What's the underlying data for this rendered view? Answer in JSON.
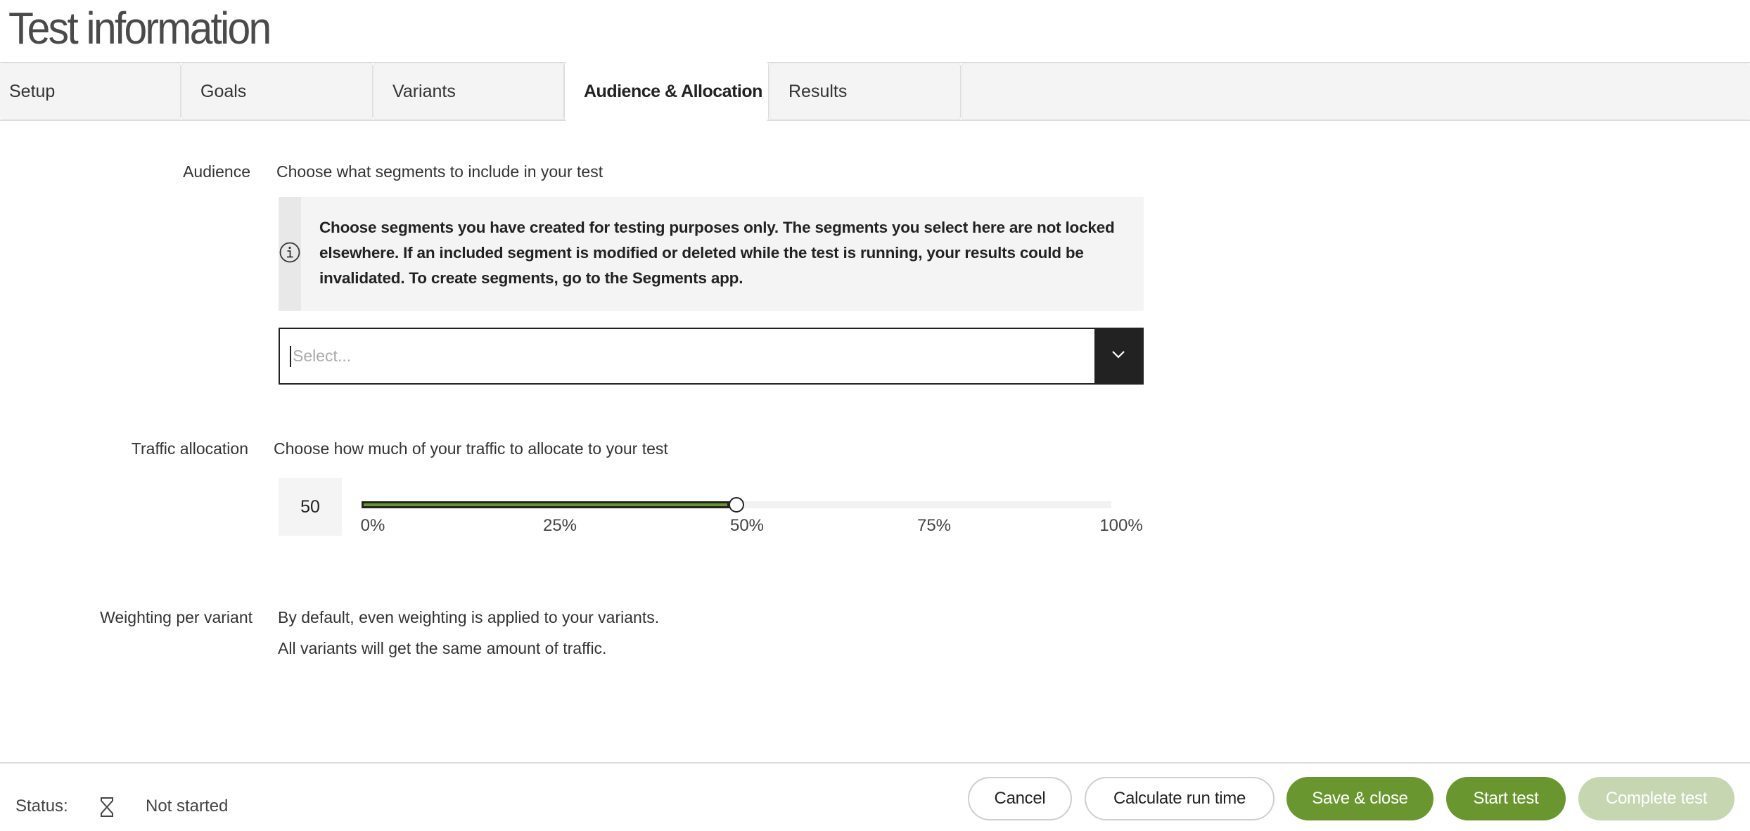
{
  "page": {
    "title": "Test information"
  },
  "tabs": [
    {
      "label": "Setup",
      "active": false
    },
    {
      "label": "Goals",
      "active": false
    },
    {
      "label": "Variants",
      "active": false
    },
    {
      "label": "Audience & Allocation",
      "active": true
    },
    {
      "label": "Results",
      "active": false
    }
  ],
  "audience": {
    "label": "Audience",
    "description": "Choose what segments to include in your test",
    "info_icon": "info-circle-icon",
    "info_text": "Choose segments you have created for testing purposes only. The segments you select here are not locked elsewhere. If an included segment is modified or deleted while the test is running, your results could be invalidated. To create segments, go to the Segments app.",
    "select": {
      "placeholder": "Select...",
      "value": "",
      "dropdown_icon": "chevron-down-icon"
    }
  },
  "traffic": {
    "label": "Traffic allocation",
    "description": "Choose how much of your traffic to allocate to your test",
    "value": "50",
    "percent": 50,
    "ticks": [
      "0%",
      "25%",
      "50%",
      "75%",
      "100%"
    ]
  },
  "weighting": {
    "label": "Weighting per variant",
    "line1": "By default, even weighting is applied to your variants.",
    "line2": "All variants will get the same amount of traffic."
  },
  "footer": {
    "status_label": "Status:",
    "status_icon": "hourglass-icon",
    "status_value": "Not started",
    "buttons": {
      "cancel": "Cancel",
      "calculate": "Calculate run time",
      "save_close": "Save & close",
      "start": "Start test",
      "complete": "Complete test"
    }
  },
  "colors": {
    "accent": "#6a962f",
    "accent_disabled": "#c5d6b0",
    "dark": "#222222",
    "panel": "#f4f4f4"
  }
}
